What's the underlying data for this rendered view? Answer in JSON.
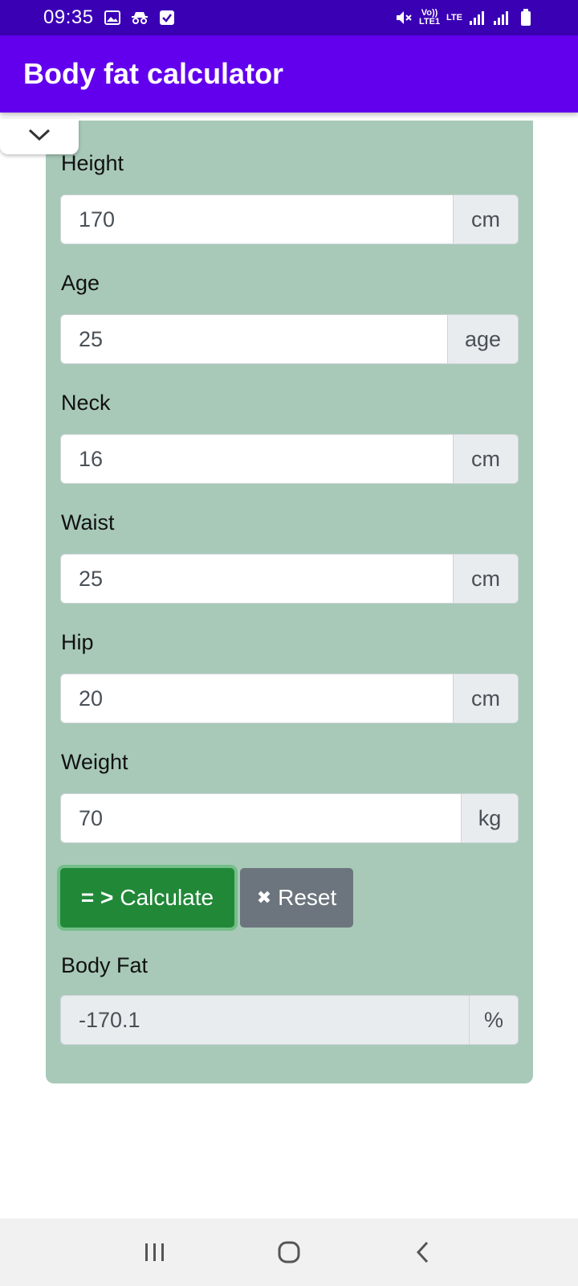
{
  "status_bar": {
    "time": "09:35",
    "volte": "Vo)) LTE1",
    "lte": "LTE",
    "icons": [
      "image-icon",
      "incognito-icon",
      "checkbox-icon",
      "mute-icon",
      "signal-icon",
      "signal-icon",
      "battery-icon"
    ]
  },
  "app_bar": {
    "title": "Body fat calculator"
  },
  "form": {
    "fields": [
      {
        "label": "Height",
        "value": "170",
        "unit": "cm"
      },
      {
        "label": "Age",
        "value": "25",
        "unit": "age"
      },
      {
        "label": "Neck",
        "value": "16",
        "unit": "cm"
      },
      {
        "label": "Waist",
        "value": "25",
        "unit": "cm"
      },
      {
        "label": "Hip",
        "value": "20",
        "unit": "cm"
      },
      {
        "label": "Weight",
        "value": "70",
        "unit": "kg"
      }
    ],
    "calculate_glyph": "= >",
    "calculate_label": "Calculate",
    "reset_glyph": "✖",
    "reset_label": "Reset",
    "result_label": "Body Fat",
    "result_value": "-170.1",
    "result_unit": "%"
  },
  "colors": {
    "status_bar": "#3a00b4",
    "app_bar": "#6200ee",
    "card": "#a8c9b8",
    "calculate_button": "#218838",
    "reset_button": "#6c757d"
  },
  "nav": {
    "icons": [
      "recent-apps-icon",
      "home-icon",
      "back-icon"
    ]
  }
}
